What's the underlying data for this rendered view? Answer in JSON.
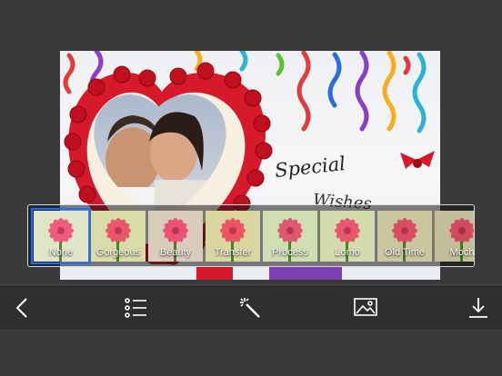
{
  "filters": {
    "items": [
      {
        "label": "None",
        "selected": true,
        "tint": "#ffffff"
      },
      {
        "label": "Gorgeous",
        "selected": false,
        "tint": "#f1e6a8"
      },
      {
        "label": "Beauty",
        "selected": false,
        "tint": "#f4c1d6"
      },
      {
        "label": "Transfer",
        "selected": false,
        "tint": "#f6d98c"
      },
      {
        "label": "Process",
        "selected": false,
        "tint": "#d9f0c0"
      },
      {
        "label": "Lomo",
        "selected": false,
        "tint": "#e8e2b8"
      },
      {
        "label": "Old Time",
        "selected": false,
        "tint": "#c9b08d"
      },
      {
        "label": "Moch",
        "selected": false,
        "tint": "#b89a7a"
      }
    ]
  },
  "card": {
    "line1": "Special",
    "line2": "Wishes"
  },
  "toolbar": {
    "icons": [
      "back-chevron-icon",
      "list-icon",
      "magic-wand-icon",
      "image-icon",
      "download-icon"
    ]
  },
  "colors": {
    "selected_border": "#1e6bff",
    "background": "#3a3a3c",
    "toolbar": "#2f2f31"
  }
}
